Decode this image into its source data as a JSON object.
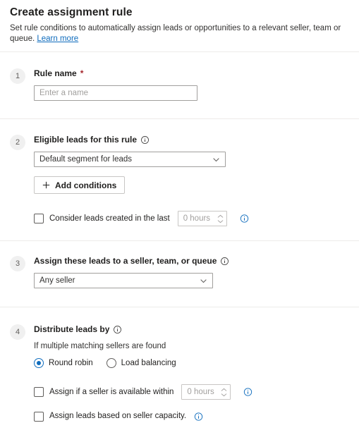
{
  "header": {
    "title": "Create assignment rule",
    "subtitle_before_link": "Set rule conditions to automatically assign leads or opportunities to a relevant seller, team or queue. ",
    "learn_more_label": "Learn more"
  },
  "colors": {
    "link": "#0f6cbd",
    "accent": "#0f6cbd",
    "required_asterisk": "#a4262c",
    "badge_background": "#f0f0f0",
    "badge_text": "#605e5c",
    "divider": "#edebe9",
    "input_border": "#a19f9d",
    "disabled_text": "#a19f9d"
  },
  "steps": [
    {
      "number": "1",
      "label": "Rule name",
      "required_marker": "*",
      "input": {
        "value": "",
        "placeholder": "Enter a name"
      }
    },
    {
      "number": "2",
      "label": "Eligible leads for this rule",
      "info_tooltip_icon": "info-circle-icon",
      "segment_dropdown": {
        "selected": "Default segment for leads",
        "chevron_icon": "chevron-down-icon"
      },
      "add_conditions_button": {
        "label": "Add conditions",
        "icon": "plus-icon"
      },
      "consider_created": {
        "checkbox_checked": false,
        "label": "Consider leads created in the last",
        "spinner_value": "0 hours",
        "spinner_up_icon": "chevron-up-icon",
        "spinner_down_icon": "chevron-down-icon",
        "info_icon": "info-circle-icon"
      }
    },
    {
      "number": "3",
      "label": "Assign these leads to a seller, team, or queue",
      "info_tooltip_icon": "info-circle-icon",
      "assignee_dropdown": {
        "selected": "Any seller",
        "chevron_icon": "chevron-down-icon"
      }
    },
    {
      "number": "4",
      "label": "Distribute leads by",
      "info_tooltip_icon": "info-circle-icon",
      "sub_note": "If multiple matching sellers are found",
      "distribution_options": [
        {
          "label": "Round robin",
          "selected": true
        },
        {
          "label": "Load balancing",
          "selected": false
        }
      ],
      "available_within": {
        "checkbox_checked": false,
        "label": "Assign if a seller is available within",
        "spinner_value": "0 hours",
        "spinner_up_icon": "chevron-up-icon",
        "spinner_down_icon": "chevron-down-icon",
        "info_icon": "info-circle-icon"
      },
      "seller_capacity": {
        "checkbox_checked": false,
        "label": "Assign leads based on seller capacity.",
        "info_icon": "info-circle-icon"
      }
    }
  ]
}
